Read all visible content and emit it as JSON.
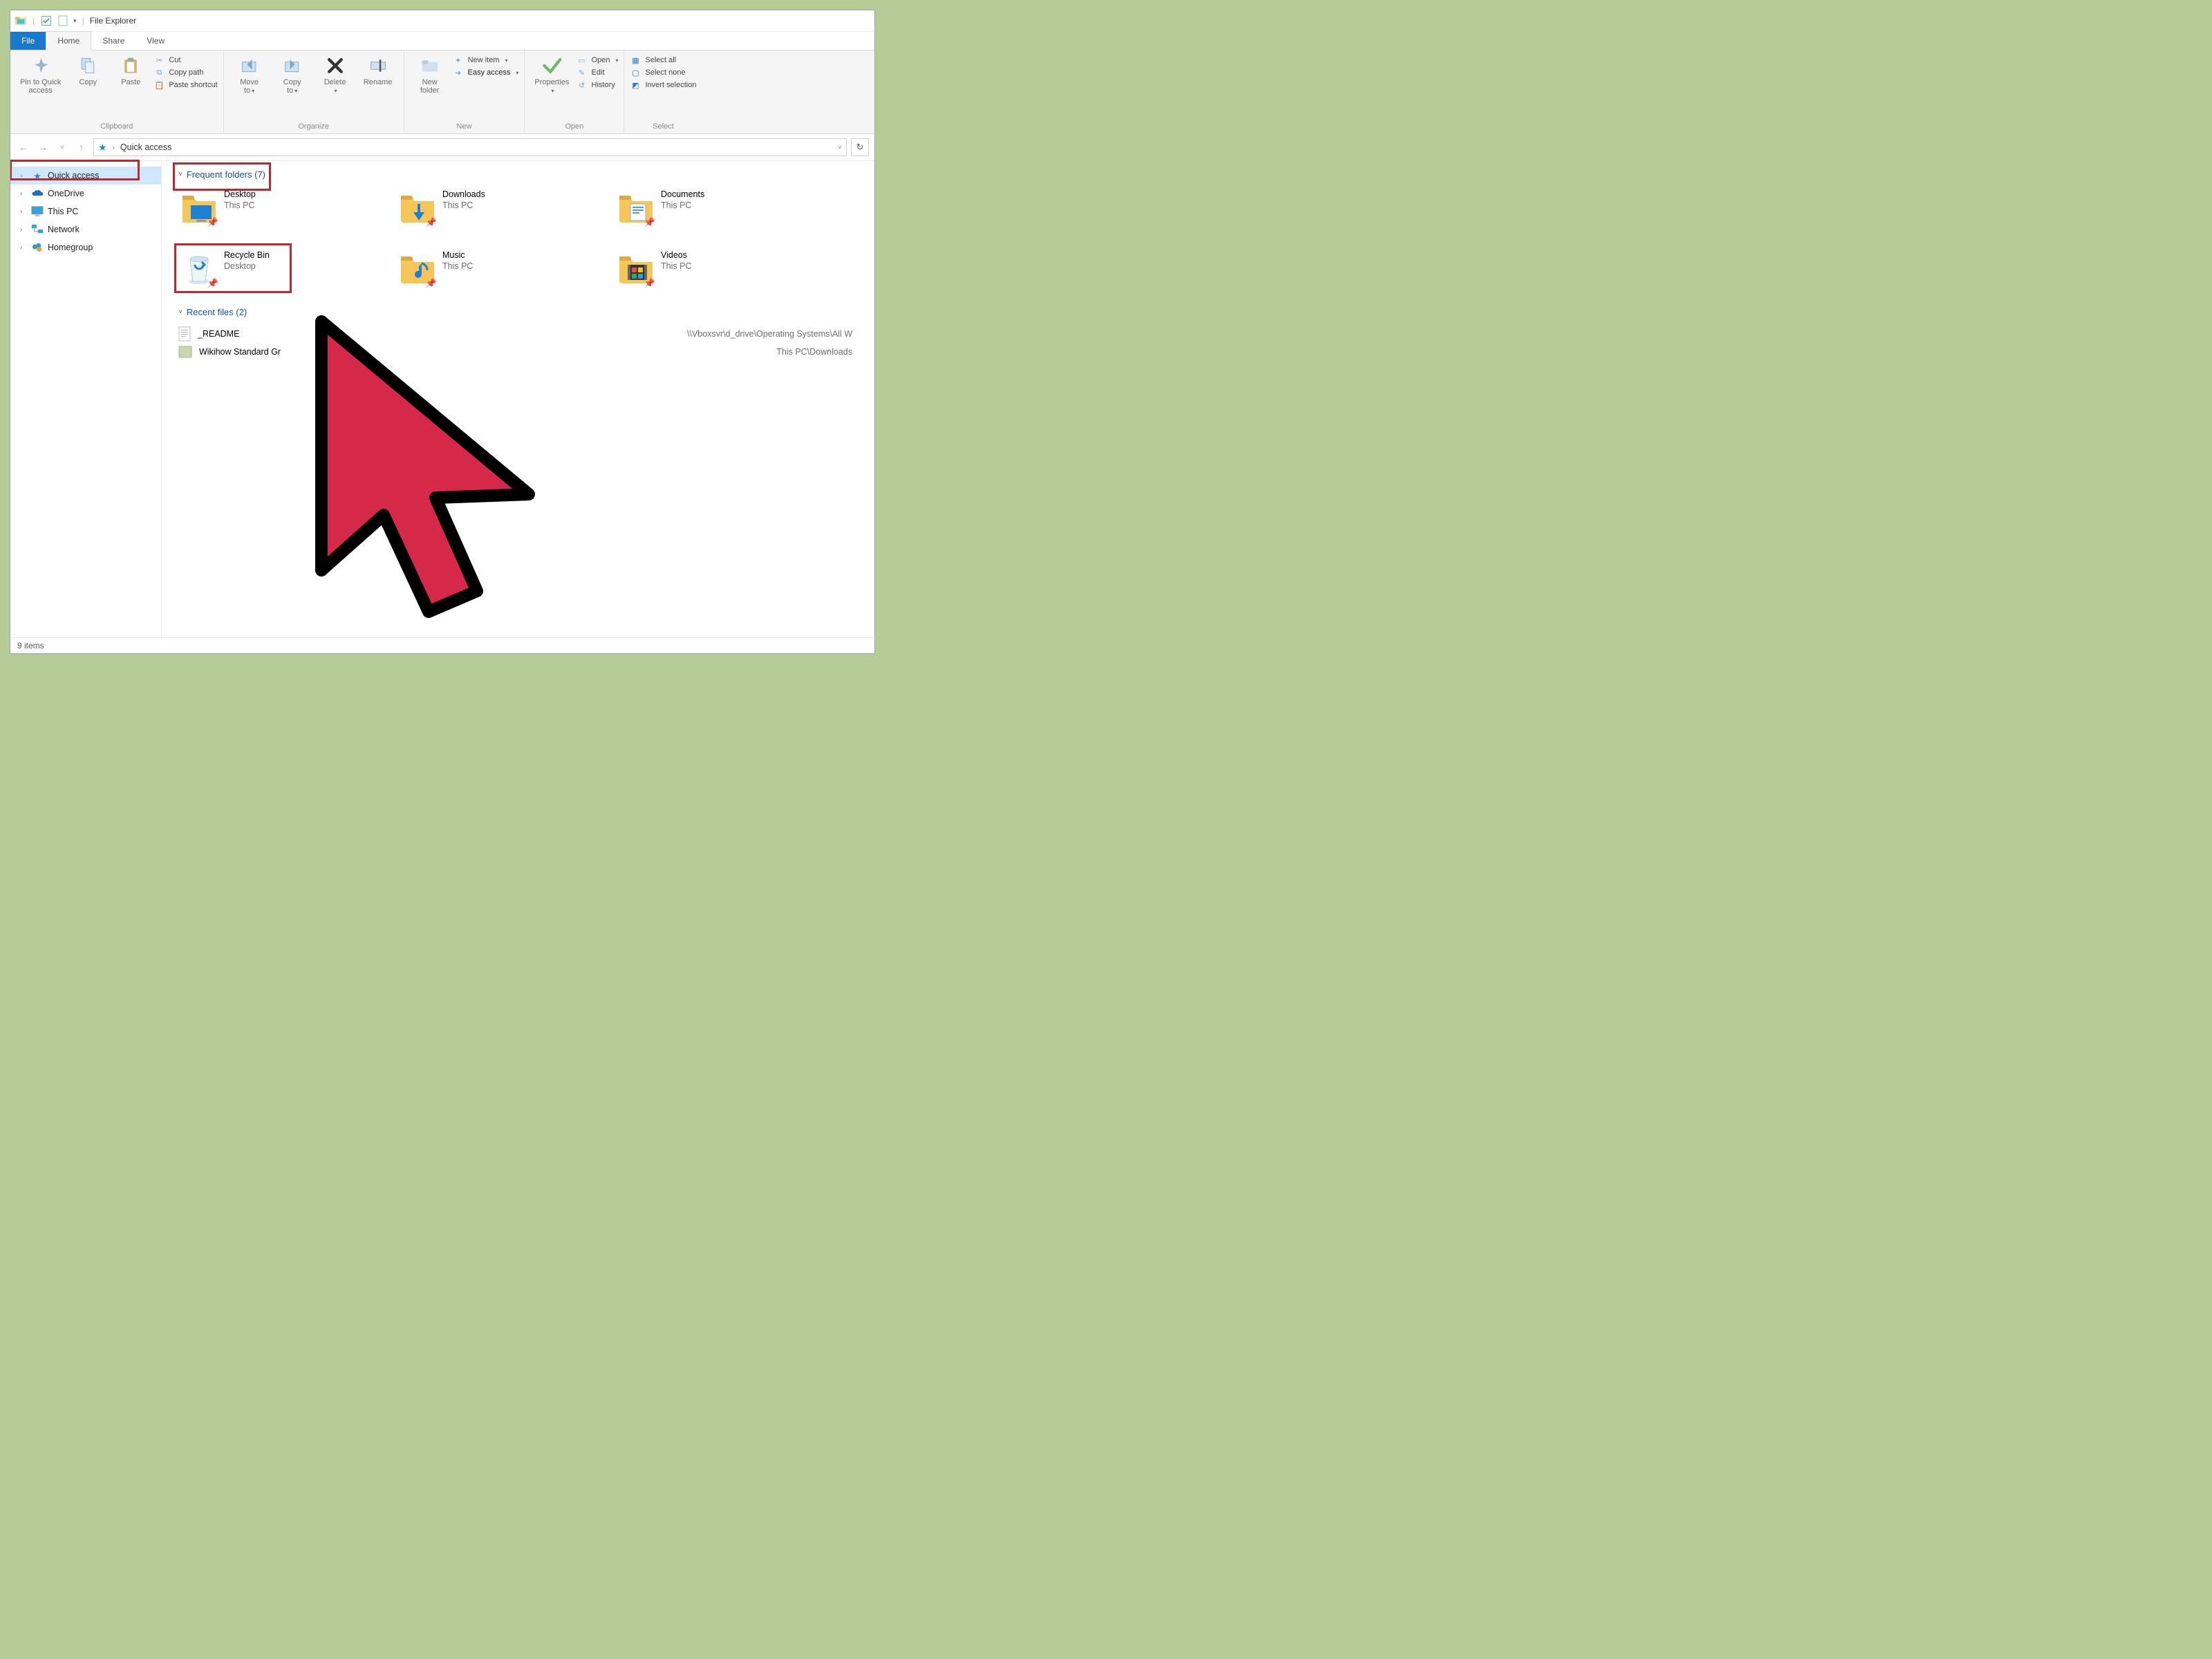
{
  "title": "File Explorer",
  "tabs": {
    "file": "File",
    "home": "Home",
    "share": "Share",
    "view": "View"
  },
  "ribbon": {
    "clipboard": {
      "label": "Clipboard",
      "pin": "Pin to Quick\naccess",
      "copy": "Copy",
      "paste": "Paste",
      "cut": "Cut",
      "copypath": "Copy path",
      "pasteshortcut": "Paste shortcut"
    },
    "organize": {
      "label": "Organize",
      "moveto": "Move\nto",
      "copyto": "Copy\nto",
      "delete": "Delete",
      "rename": "Rename"
    },
    "new": {
      "label": "New",
      "newfolder": "New\nfolder",
      "newitem": "New item",
      "easyaccess": "Easy access"
    },
    "open": {
      "label": "Open",
      "properties": "Properties",
      "open": "Open",
      "edit": "Edit",
      "history": "History"
    },
    "select": {
      "label": "Select",
      "all": "Select all",
      "none": "Select none",
      "invert": "Invert selection"
    }
  },
  "address": {
    "root": "Quick access"
  },
  "tree": {
    "quick": "Quick access",
    "onedrive": "OneDrive",
    "thispc": "This PC",
    "network": "Network",
    "homegroup": "Homegroup"
  },
  "sections": {
    "frequent": "Frequent folders (7)",
    "recent": "Recent files (2)"
  },
  "folders": [
    {
      "name": "Desktop",
      "loc": "This PC"
    },
    {
      "name": "Downloads",
      "loc": "This PC"
    },
    {
      "name": "Documents",
      "loc": "This PC"
    },
    {
      "name": "Recycle Bin",
      "loc": "Desktop"
    },
    {
      "name": "Music",
      "loc": "This PC"
    },
    {
      "name": "Videos",
      "loc": "This PC"
    }
  ],
  "recent": [
    {
      "name": "_README",
      "path": "\\\\Vboxsvr\\d_drive\\Operating Systems\\All W"
    },
    {
      "name": "Wikihow Standard Gr",
      "path": "This PC\\Downloads"
    }
  ],
  "status": "9 items"
}
